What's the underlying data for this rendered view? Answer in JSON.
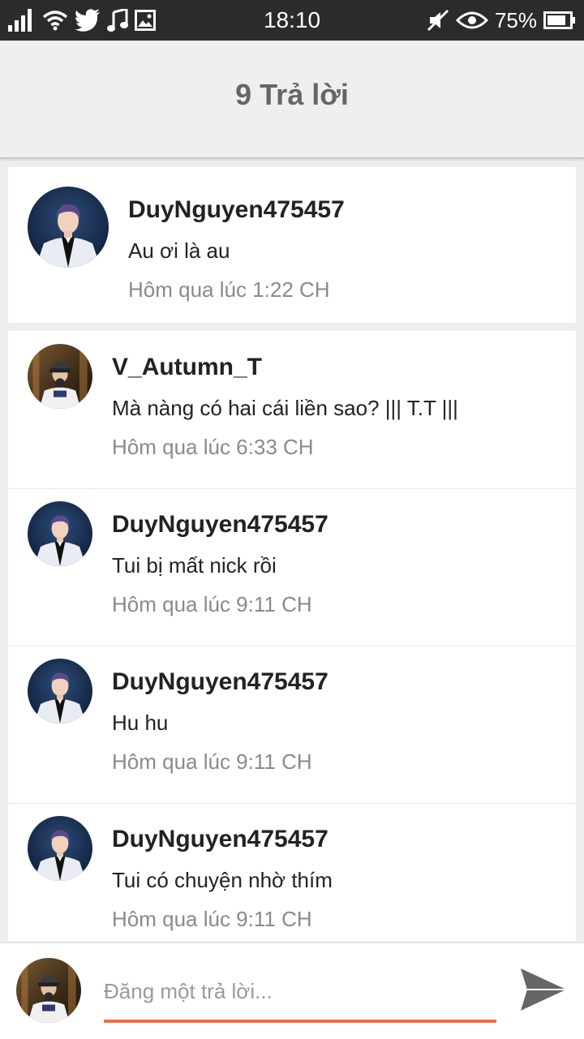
{
  "status_bar": {
    "time": "18:10",
    "battery": "75%"
  },
  "header": {
    "title": "9 Trả lời"
  },
  "main_comment": {
    "username": "DuyNguyen475457",
    "message": "Au ơi là au",
    "timestamp": "Hôm qua lúc 1:22 CH"
  },
  "replies": [
    {
      "username": "V_Autumn_T",
      "message": "Mà nàng có hai cái liền sao? ||| T.T |||",
      "timestamp": "Hôm qua lúc 6:33 CH"
    },
    {
      "username": "DuyNguyen475457",
      "message": "Tui bị mất nick rồi",
      "timestamp": "Hôm qua lúc 9:11 CH"
    },
    {
      "username": "DuyNguyen475457",
      "message": "Hu hu",
      "timestamp": "Hôm qua lúc 9:11 CH"
    },
    {
      "username": "DuyNguyen475457",
      "message": "Tui có chuyện nhờ thím",
      "timestamp": "Hôm qua lúc 9:11 CH"
    }
  ],
  "composer": {
    "placeholder": "Đăng một trả lời..."
  },
  "colors": {
    "accent": "#f26d3d",
    "status_bar": "#2b2b2b",
    "header_bg": "#efefef"
  }
}
